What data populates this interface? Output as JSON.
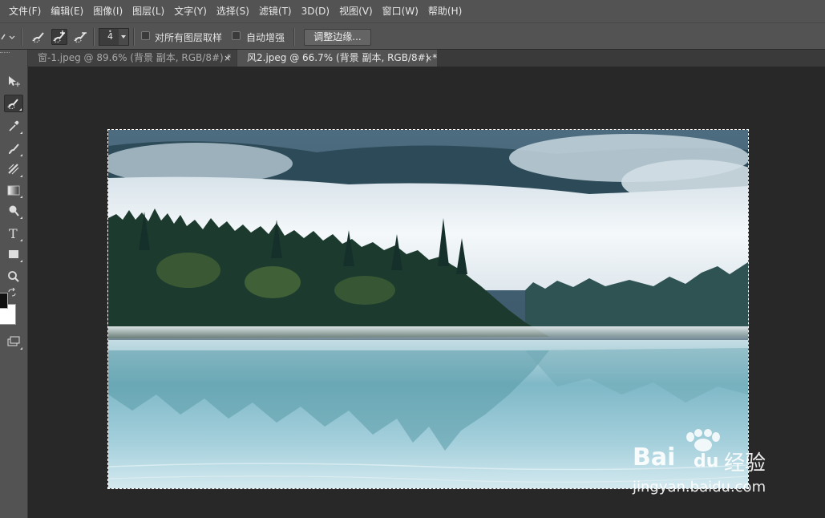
{
  "menubar": {
    "items": [
      "文件(F)",
      "编辑(E)",
      "图像(I)",
      "图层(L)",
      "文字(Y)",
      "选择(S)",
      "滤镜(T)",
      "3D(D)",
      "视图(V)",
      "窗口(W)",
      "帮助(H)"
    ]
  },
  "options": {
    "brush_size": "4",
    "sample_all_layers_label": "对所有图层取样",
    "sample_all_layers_checked": false,
    "auto_enhance_label": "自动增强",
    "auto_enhance_checked": false,
    "refine_edge_label": "调整边缘..."
  },
  "tabs": [
    {
      "label": "窗-1.jpeg @ 89.6% (背景 副本, RGB/8#) *",
      "active": false,
      "close": "×"
    },
    {
      "label": "风2.jpeg @ 66.7% (背景 副本, RGB/8#) *",
      "active": true,
      "close": "×"
    }
  ],
  "tools": [
    "move-tool-icon",
    "quick-selection-tool-icon",
    "eyedropper-tool-icon",
    "brush-tool-icon",
    "history-brush-tool-icon",
    "gradient-tool-icon",
    "dodge-tool-icon",
    "type-tool-icon",
    "rectangle-tool-icon",
    "zoom-tool-icon",
    "swap-colors-icon",
    "screen-mode-icon"
  ],
  "colors": {
    "foreground": "#111111",
    "background": "#ffffff",
    "ui_panel": "#535353",
    "workspace": "#282828"
  },
  "watermark": {
    "brand": "Bai",
    "brand_suffix": "du",
    "product": "经验",
    "url": "jingyan.baidu.com"
  }
}
